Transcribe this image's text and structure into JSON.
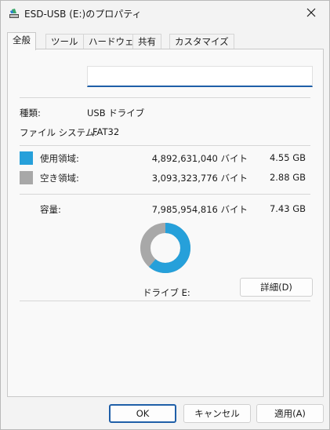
{
  "window": {
    "title": "ESD-USB (E:)のプロパティ"
  },
  "tabs": [
    {
      "label": "全般",
      "active": true
    },
    {
      "label": "ツール",
      "active": false
    },
    {
      "label": "ハードウェア",
      "active": false
    },
    {
      "label": "共有",
      "active": false
    },
    {
      "label": "カスタマイズ",
      "active": false
    }
  ],
  "general": {
    "volume_name_value": "",
    "type_label": "種類:",
    "type_value": "USB ドライブ",
    "fs_label": "ファイル システム:",
    "fs_value": "FAT32",
    "used_label": "使用領域:",
    "used_bytes": "4,892,631,040 バイト",
    "used_size": "4.55 GB",
    "free_label": "空き領域:",
    "free_bytes": "3,093,323,776 バイト",
    "free_size": "2.88 GB",
    "capacity_label": "容量:",
    "capacity_bytes": "7,985,954,816 バイト",
    "capacity_size": "7.43 GB",
    "used_fraction": 0.613,
    "drive_label": "ドライブ E:",
    "details_button": "詳細(D)"
  },
  "colors": {
    "used": "#26a0da",
    "free": "#a8a8a8",
    "accent": "#1f5fa8"
  },
  "buttons": {
    "ok": "OK",
    "cancel": "キャンセル",
    "apply": "適用(A)"
  },
  "icons": {
    "title_icon": "usb-drive-icon",
    "close_icon": "close-icon"
  }
}
